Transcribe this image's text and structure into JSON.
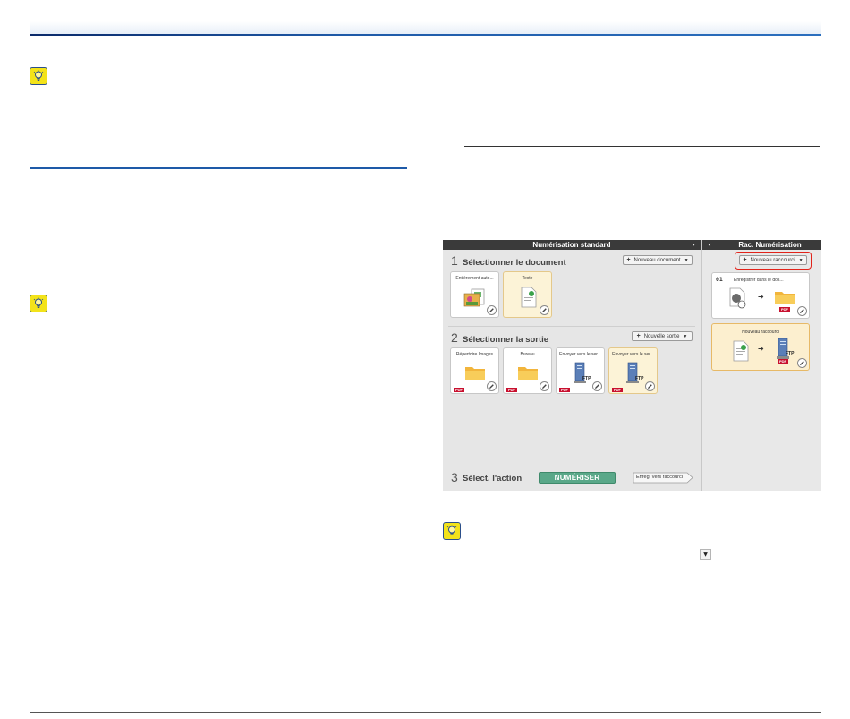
{
  "screenshot": {
    "main_title": "Numérisation standard",
    "side_title": "Rac. Numérisation",
    "chevron_right": "›",
    "chevron_left": "‹",
    "step1": {
      "num": "1",
      "label": "Sélectionner le document",
      "button": "Nouveau document"
    },
    "step2": {
      "num": "2",
      "label": "Sélectionner la sortie",
      "button": "Nouvelle sortie"
    },
    "step3": {
      "num": "3",
      "label": "Sélect. l'action",
      "scan_button": "NUMÉRISER",
      "save_shortcut": "Enreg. vers raccourci"
    },
    "documents": [
      {
        "label": "Entièrement auto...",
        "icon": "photo-document-icon"
      },
      {
        "label": "Texte",
        "icon": "text-document-icon"
      }
    ],
    "outputs": [
      {
        "label": "Répertoire Images",
        "icon": "folder-icon",
        "badge": "PDF"
      },
      {
        "label": "Bureau",
        "icon": "folder-icon",
        "badge": "PDF"
      },
      {
        "label": "Envoyer vers le ser...",
        "icon": "ftp-server-icon",
        "badge": "PDF",
        "tag": "FTP"
      },
      {
        "label": "Envoyer vers le ser...",
        "icon": "ftp-server-icon",
        "badge": "PDF",
        "tag": "FTP"
      }
    ],
    "new_shortcut_button": "Nouveau raccourci",
    "shortcuts": [
      {
        "num": "01",
        "label": "Enregistrer dans le dos...",
        "badge": "PDF"
      },
      {
        "label": "Nouveau raccourci",
        "badge": "PDF",
        "tag": "FTP"
      }
    ]
  },
  "colors": {
    "accent_blue": "#1e5aa8",
    "scan_green": "#5aa889",
    "highlight_red": "#e2231a",
    "pdf_red": "#c8102e",
    "selected_card": "#fcf3d7",
    "hint_yellow": "#f3e31a"
  },
  "icons": [
    "lightbulb-hint-icon",
    "plus-icon",
    "caret-down-icon",
    "pencil-icon",
    "arrow-right-icon",
    "folder-icon",
    "ftp-server-icon"
  ]
}
